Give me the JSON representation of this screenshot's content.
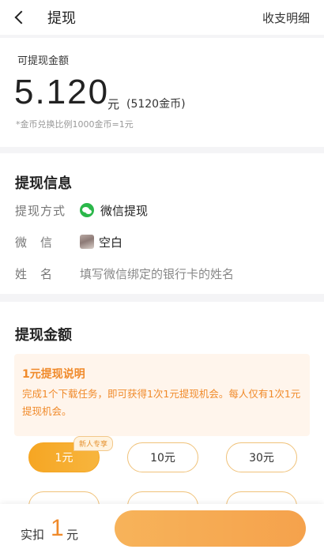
{
  "header": {
    "title": "提现",
    "detail_link": "收支明细"
  },
  "balance": {
    "label": "可提现金额",
    "amount": "5.120",
    "unit": "元",
    "coins": "(5120金币)",
    "rate_note": "*金币兑换比例1000金币=1元"
  },
  "info": {
    "title": "提现信息",
    "method_label": "提现方式",
    "method_value": "微信提现",
    "wechat_label": "微　信",
    "wechat_name": "空白",
    "name_label": "姓　名",
    "name_placeholder": "填写微信绑定的银行卡的姓名"
  },
  "withdraw": {
    "title": "提现金额",
    "notice_title": "1元提现说明",
    "notice_body": "完成1个下载任务，即可获得1次1元提现机会。每人仅有1次1元提现机会。",
    "badge": "新人专享",
    "options": [
      "1元",
      "10元",
      "30元"
    ],
    "selected_index": 0
  },
  "footer": {
    "deduct_label": "实扣",
    "deduct_value": "1",
    "deduct_unit": "元"
  },
  "colors": {
    "accent": "#f6a623",
    "notice_text": "#f08a2a",
    "wechat": "#2bb74a"
  }
}
